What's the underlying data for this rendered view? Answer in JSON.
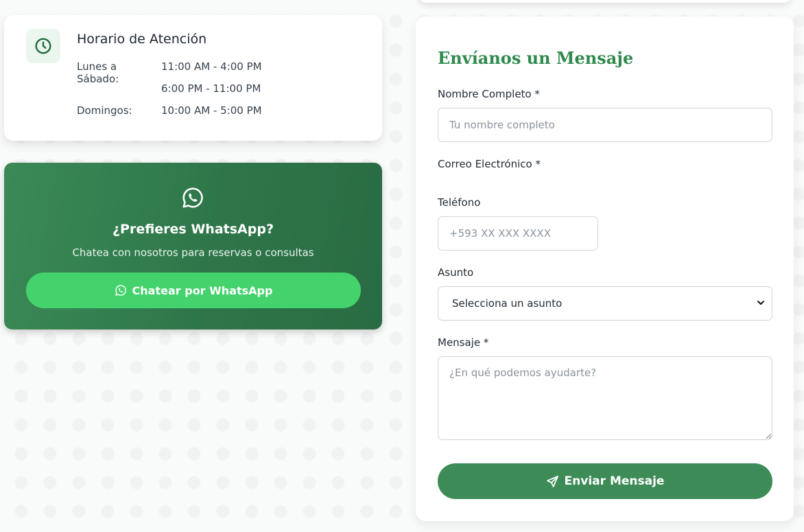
{
  "hours": {
    "icon": "clock-icon",
    "title": "Horario de Atención",
    "rows": [
      {
        "day": "Lunes a Sábado:",
        "time": "11:00 AM - 4:00 PM"
      },
      {
        "day": "",
        "time": "6:00 PM - 11:00 PM"
      },
      {
        "day": "Domingos:",
        "time": "10:00 AM - 5:00 PM"
      }
    ]
  },
  "whatsapp": {
    "icon": "whatsapp-icon",
    "title": "¿Prefieres WhatsApp?",
    "subtitle": "Chatea con nosotros para reservas o consultas",
    "button_label": "Chatear por WhatsApp",
    "button_color": "#43d26b",
    "card_color": "#2e7649"
  },
  "form": {
    "title": "Envíanos un Mensaje",
    "name": {
      "label": "Nombre Completo *",
      "placeholder": "Tu nombre completo"
    },
    "email": {
      "label": "Correo Electrónico *"
    },
    "phone": {
      "label": "Teléfono",
      "placeholder": "+593 XX XXX XXXX"
    },
    "subject": {
      "label": "Asunto",
      "selected": "Selecciona un asunto"
    },
    "message": {
      "label": "Mensaje *",
      "placeholder": "¿En qué podemos ayudarte?"
    },
    "submit_label": "Enviar Mensaje",
    "submit_icon": "paper-plane-icon",
    "accent_color": "#2f8a4c"
  }
}
